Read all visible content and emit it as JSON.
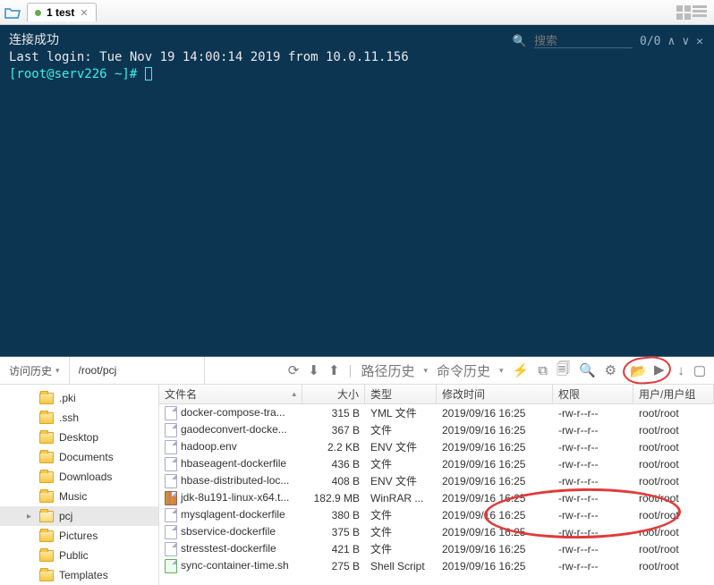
{
  "tab": {
    "title": "1 test"
  },
  "terminal": {
    "line1": "连接成功",
    "line2": "Last login: Tue Nov 19 14:00:14 2019 from 10.0.11.156",
    "prompt_user": "[root@serv226 ~]#",
    "search_placeholder": "搜索",
    "search_count": "0/0"
  },
  "toolbar": {
    "visit_history": "访问历史",
    "path": "/root/pcj",
    "path_history": "路径历史",
    "cmd_history": "命令历史"
  },
  "tree": {
    "items": [
      {
        "label": ".pki"
      },
      {
        "label": ".ssh"
      },
      {
        "label": "Desktop"
      },
      {
        "label": "Documents"
      },
      {
        "label": "Downloads"
      },
      {
        "label": "Music"
      },
      {
        "label": "pcj",
        "active": true
      },
      {
        "label": "Pictures"
      },
      {
        "label": "Public"
      },
      {
        "label": "Templates"
      }
    ]
  },
  "columns": {
    "name": "文件名",
    "size": "大小",
    "type": "类型",
    "mtime": "修改时间",
    "perm": "权限",
    "owner": "用户/用户组"
  },
  "files": [
    {
      "name": "docker-compose-tra...",
      "size": "315 B",
      "type": "YML 文件",
      "mtime": "2019/09/16 16:25",
      "perm": "-rw-r--r--",
      "owner": "root/root",
      "ic": "file"
    },
    {
      "name": "gaodeconvert-docke...",
      "size": "367 B",
      "type": "文件",
      "mtime": "2019/09/16 16:25",
      "perm": "-rw-r--r--",
      "owner": "root/root",
      "ic": "file"
    },
    {
      "name": "hadoop.env",
      "size": "2.2 KB",
      "type": "ENV 文件",
      "mtime": "2019/09/16 16:25",
      "perm": "-rw-r--r--",
      "owner": "root/root",
      "ic": "file"
    },
    {
      "name": "hbaseagent-dockerfile",
      "size": "436 B",
      "type": "文件",
      "mtime": "2019/09/16 16:25",
      "perm": "-rw-r--r--",
      "owner": "root/root",
      "ic": "file"
    },
    {
      "name": "hbase-distributed-loc...",
      "size": "408 B",
      "type": "ENV 文件",
      "mtime": "2019/09/16 16:25",
      "perm": "-rw-r--r--",
      "owner": "root/root",
      "ic": "file"
    },
    {
      "name": "jdk-8u191-linux-x64.t...",
      "size": "182.9 MB",
      "type": "WinRAR ...",
      "mtime": "2019/09/16 16:25",
      "perm": "-rw-r--r--",
      "owner": "root/root",
      "ic": "archive"
    },
    {
      "name": "mysqlagent-dockerfile",
      "size": "380 B",
      "type": "文件",
      "mtime": "2019/09/16 16:25",
      "perm": "-rw-r--r--",
      "owner": "root/root",
      "ic": "file"
    },
    {
      "name": "sbservice-dockerfile",
      "size": "375 B",
      "type": "文件",
      "mtime": "2019/09/16 16:25",
      "perm": "-rw-r--r--",
      "owner": "root/root",
      "ic": "file"
    },
    {
      "name": "stresstest-dockerfile",
      "size": "421 B",
      "type": "文件",
      "mtime": "2019/09/16 16:25",
      "perm": "-rw-r--r--",
      "owner": "root/root",
      "ic": "file"
    },
    {
      "name": "sync-container-time.sh",
      "size": "275 B",
      "type": "Shell Script",
      "mtime": "2019/09/16 16:25",
      "perm": "-rw-r--r--",
      "owner": "root/root",
      "ic": "script"
    }
  ]
}
